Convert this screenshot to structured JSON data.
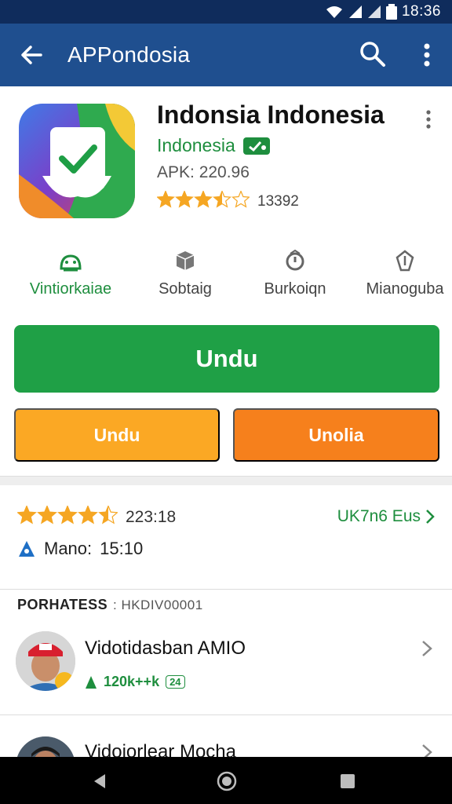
{
  "status_bar": {
    "time": "18:36"
  },
  "app_bar": {
    "title": "APPondosia",
    "back_icon": "arrow-left-icon",
    "search_icon": "search-icon",
    "more_icon": "more-vert-icon"
  },
  "app": {
    "name": "Indonsia Indonesia",
    "developer": "Indonesia",
    "apk": "APK: 220.96",
    "rating_value": 3.5,
    "rating_count": "13392"
  },
  "categories": [
    {
      "label": "Vintiorkaiae",
      "icon": "android-icon"
    },
    {
      "label": "Sobtaig",
      "icon": "box-icon"
    },
    {
      "label": "Burkoiqn",
      "icon": "alert-icon"
    },
    {
      "label": "Mianoguba",
      "icon": "shield-icon"
    }
  ],
  "buttons": {
    "main": "Undu",
    "left": "Undu",
    "right": "Unolia"
  },
  "ratings_summary": {
    "rating_value": 4.5,
    "value_text": "223:18",
    "reviews_link": "UK7n6 Eus",
    "mano_label": "Mano:",
    "mano_value": "15:10"
  },
  "section": {
    "title": "PORHATESS",
    "subtitle": ": HKDIV00001"
  },
  "videos": [
    {
      "title": "Vidotidasban AMIO",
      "meta": "120k++k",
      "badge": "24"
    },
    {
      "title": "Vidoiorlear Mocha"
    }
  ],
  "colors": {
    "status_bar": "#0f2c5c",
    "app_bar": "#1f4f8f",
    "green": "#1fa046",
    "yellow": "#fba824",
    "orange": "#f6801c",
    "star": "#f5a623"
  }
}
